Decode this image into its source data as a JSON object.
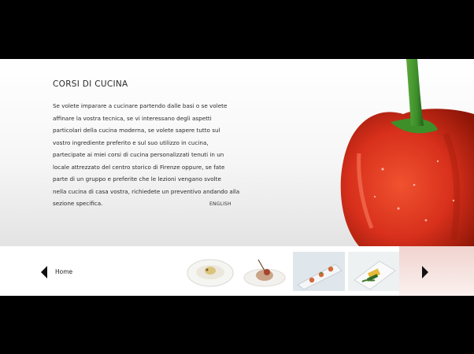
{
  "content": {
    "title": "CORSI DI CUCINA",
    "paragraph_lines": [
      "Se volete imparare a cucinare partendo dalle basi o se volete",
      "affinare la vostra tecnica, se vi interessano degli aspetti",
      "particolari della cucina moderna, se volete sapere tutto sul",
      "vostro ingrediente preferito e sul suo utilizzo in cucina,",
      "partecipate ai miei corsi di cucina personalizzati tenuti in un",
      "locale attrezzato del centro storico di Firenze oppure,  se fate",
      "parte di un gruppo e preferite che le lezioni vengano svolte",
      "nella cucina di casa vostra, richiedete un preventivo andando alla",
      "sezione specifica."
    ],
    "language_link": "ENGLISH"
  },
  "nav": {
    "home_label": "Home"
  },
  "thumbnails": [
    {
      "icon": "dish-plate-icon"
    },
    {
      "icon": "dessert-bowl-icon"
    },
    {
      "icon": "appetizer-tray-icon"
    },
    {
      "icon": "vegetable-plate-icon"
    }
  ],
  "colors": {
    "pepper_red": "#d8301c",
    "stem_green": "#3d8f2a",
    "background_black": "#000000"
  }
}
